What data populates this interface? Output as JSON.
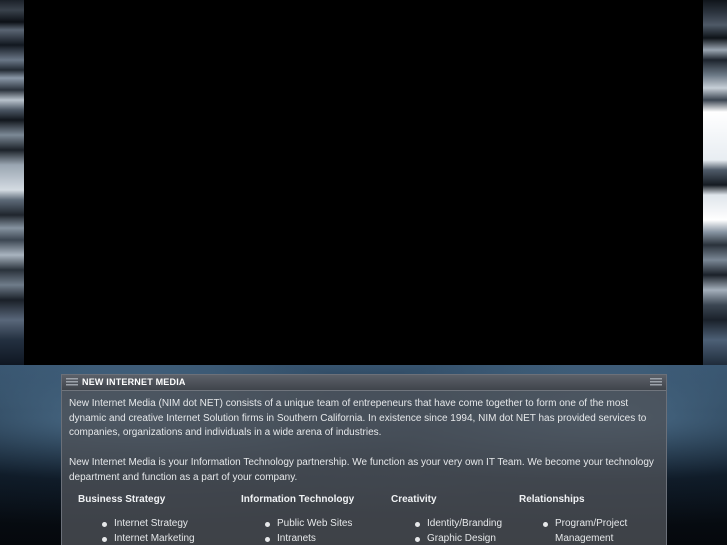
{
  "panel": {
    "title": "NEW INTERNET MEDIA",
    "paragraphs": [
      "New Internet Media (NIM dot NET) consists of a unique team of entrepeneurs that have come together to form one of the most dynamic and creative Internet Solution firms in Southern California. In existence since 1994, NIM dot NET has provided services to companies, organizations and individuals in a wide arena of industries.",
      "New Internet Media is your Information Technology partnership. We function as your very own IT Team. We become your technology department and function as a part of your company."
    ]
  },
  "columns": [
    {
      "title": "Business Strategy",
      "items": [
        "Internet Strategy",
        "Internet Marketing"
      ]
    },
    {
      "title": "Information Technology",
      "items": [
        "Public Web Sites",
        "Intranets"
      ]
    },
    {
      "title": "Creativity",
      "items": [
        "Identity/Branding",
        "Graphic Design"
      ]
    },
    {
      "title": "Relationships",
      "items": [
        "Program/Project",
        "Management"
      ]
    }
  ],
  "icons": {
    "header_left": "decorative-stripes-icon",
    "header_right": "decorative-stripes-icon",
    "bullet": "bullet-icon"
  }
}
